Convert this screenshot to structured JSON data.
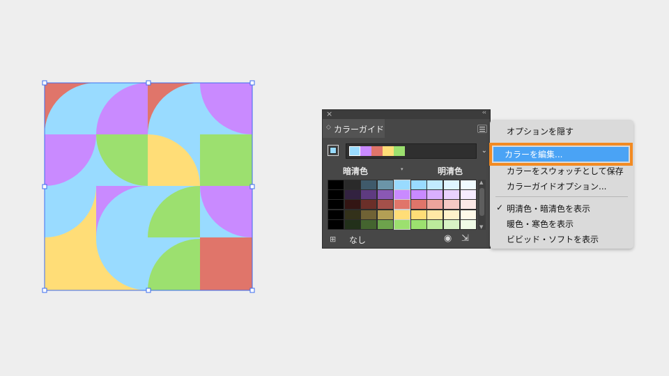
{
  "artwork": {
    "colors": {
      "blue": "#99dbff",
      "purple": "#c98aff",
      "green": "#9ce06f",
      "yellow": "#ffdd77",
      "red": "#e0756a",
      "selection": "#3b6cf0"
    }
  },
  "panel": {
    "title": "カラーガイド",
    "close_icon": "close-icon",
    "collapse_icon": "collapse-icon",
    "base_color": "#99dbff",
    "harmony_colors": [
      "#99dbff",
      "#c98aff",
      "#e0756a",
      "#ffdd77",
      "#9ce06f"
    ],
    "variation_left": "暗清色",
    "variation_right": "明清色",
    "grid": [
      [
        "#000000",
        "#2a2a2a",
        "#3f5a6b",
        "#6b95a8",
        "#99dbff",
        "#99dbff",
        "#c2ebff",
        "#dff5ff",
        "#f0fbff"
      ],
      [
        "#000000",
        "#322240",
        "#5e3b80",
        "#8a58b4",
        "#c98aff",
        "#c98aff",
        "#dab0ff",
        "#ead2ff",
        "#f6ecff"
      ],
      [
        "#000000",
        "#331513",
        "#6b2f29",
        "#a4504a",
        "#e0756a",
        "#e0756a",
        "#eca49c",
        "#f5c9c4",
        "#fbe8e6"
      ],
      [
        "#000000",
        "#33311a",
        "#706235",
        "#b39f55",
        "#ffdd77",
        "#ffdd77",
        "#ffe8a5",
        "#fff2cb",
        "#fffae9"
      ],
      [
        "#000000",
        "#22301a",
        "#44642f",
        "#6da34c",
        "#9ce06f",
        "#9ce06f",
        "#bcea9c",
        "#d8f3c5",
        "#f0fbe7"
      ]
    ],
    "limit_label": "なし"
  },
  "flyout": {
    "items": {
      "hide_options": "オプションを隠す",
      "edit_colors": "カラーを編集...",
      "save_swatch": "カラーをスウォッチとして保存",
      "guide_options": "カラーガイドオプション...",
      "show_tint_shade": "明清色・暗清色を表示",
      "show_warm_cool": "暖色・寒色を表示",
      "show_vivid_muted": "ビビッド・ソフトを表示"
    },
    "checkmark": "✓",
    "highlight_color": "#f28a22"
  }
}
